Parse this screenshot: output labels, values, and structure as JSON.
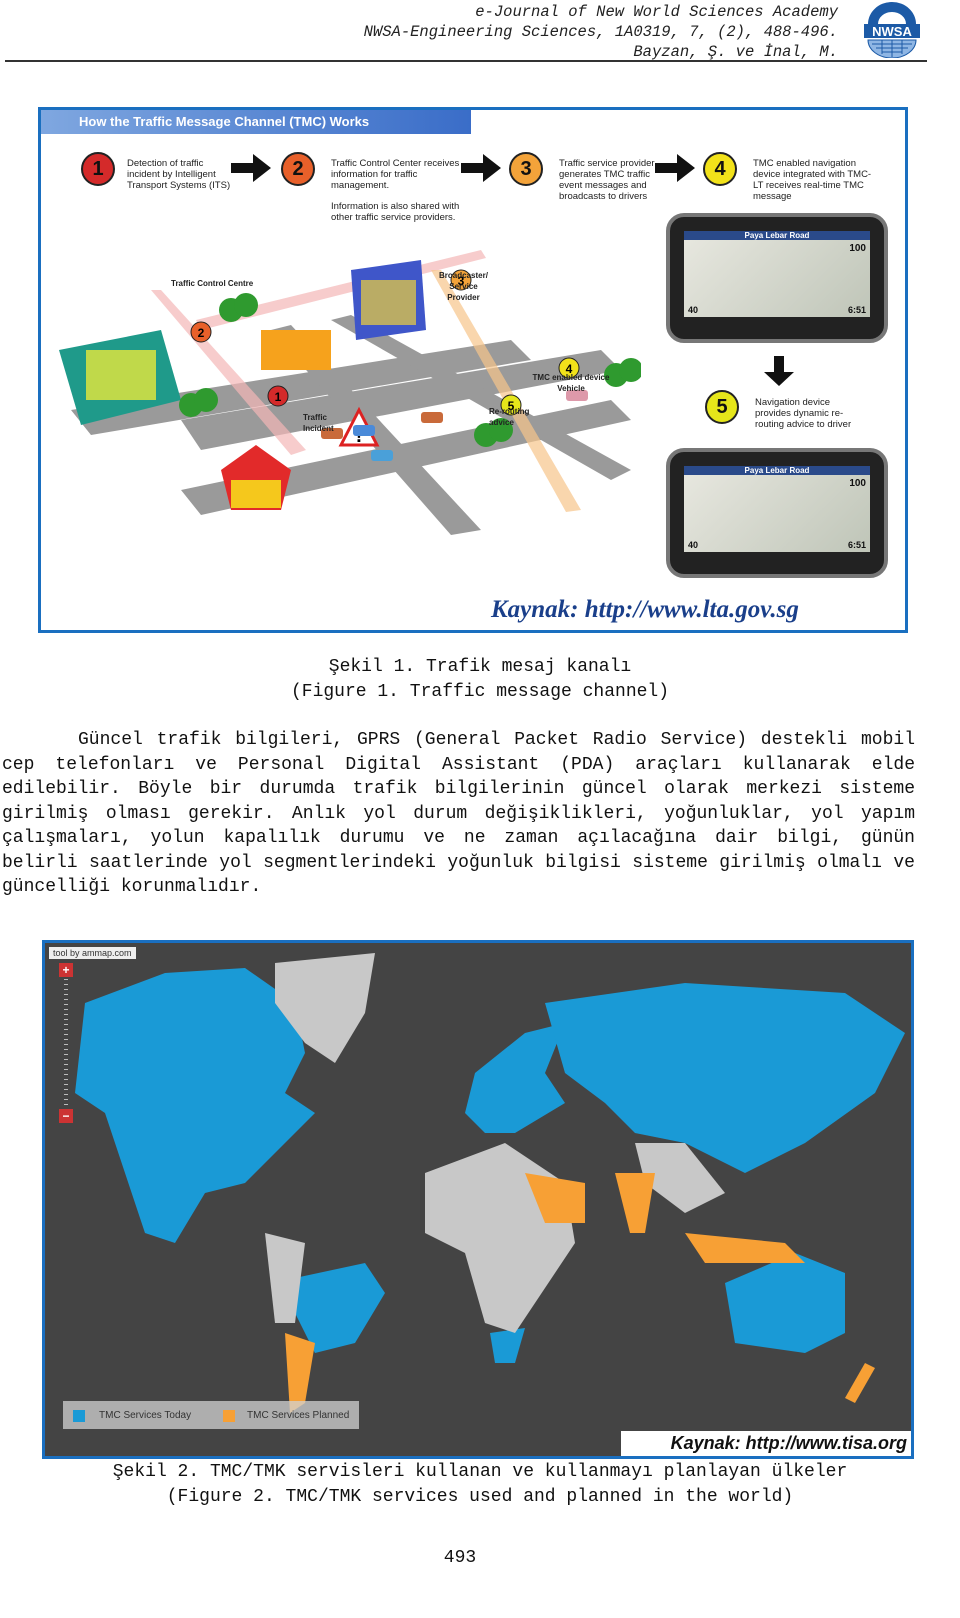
{
  "header": {
    "journal": "e-Journal of New World Sciences Academy",
    "citation": "NWSA-Engineering Sciences, 1A0319, 7, (2), 488-496.",
    "authors": "Bayzan, Ş. ve İnal, M.",
    "logo_text": "NWSA"
  },
  "figure1": {
    "banner": "How the Traffic Message Channel (TMC) Works",
    "steps": [
      {
        "num": "1",
        "text": "Detection of traffic incident by Intelligent Transport Systems (ITS)",
        "color": "#d42a2a"
      },
      {
        "num": "2",
        "text": "Traffic Control Center receives information for traffic management.",
        "extra": "Information is also shared with other traffic service providers.",
        "color": "#e8602a"
      },
      {
        "num": "3",
        "text": "Traffic service provider generates TMC traffic event messages and broadcasts to drivers",
        "color": "#f3a33a"
      },
      {
        "num": "4",
        "text": "TMC enabled navigation device integrated with TMC-LT receives real-time TMC message",
        "color": "#f2e21a"
      },
      {
        "num": "5",
        "text": "Navigation device provides dynamic re-routing advice to driver",
        "color": "#e6e61a"
      }
    ],
    "scene_labels": {
      "control": "Traffic Control Centre",
      "broadcaster": "Broadcaster/ Service Provider",
      "vehicle": "TMC enabled device Vehicle",
      "incident": "Traffic Incident",
      "rerouting": "Re-routing advice"
    },
    "gps": {
      "road": "Paya Lebar Road",
      "distance": "100",
      "speed": "40",
      "time": "6:51"
    },
    "source": "Kaynak: http://www.lta.gov.sg",
    "caption_tr": "Şekil 1. Trafik mesaj kanalı",
    "caption_en": "(Figure 1. Traffic message channel)"
  },
  "paragraph": "Güncel trafik bilgileri, GPRS (General Packet Radio Service) destekli mobil cep telefonları ve Personal Digital Assistant (PDA) araçları kullanarak elde edilebilir. Böyle bir durumda trafik bilgilerinin güncel olarak merkezi sisteme girilmiş olması gerekir. Anlık yol durum değişiklikleri, yoğunluklar, yol yapım çalışmaları, yolun kapalılık durumu ve ne zaman açılacağına dair bilgi, günün belirli saatlerinde yol segmentlerindeki yoğunluk bilgisi sisteme girilmiş olmalı ve güncelliği korunmalıdır.",
  "figure2": {
    "credit": "tool by ammap.com",
    "legend": [
      {
        "label": "TMC Services Today",
        "color": "#1a9ad6"
      },
      {
        "label": "TMC Services Planned",
        "color": "#f7a035"
      }
    ],
    "none_color": "#c8c8c8",
    "background": "#444444",
    "source": "Kaynak: http://www.tisa.org",
    "caption_tr": "Şekil 2. TMC/TMK servisleri kullanan ve kullanmayı planlayan ülkeler",
    "caption_en": "(Figure 2. TMC/TMK services used and planned in the world)"
  },
  "page_number": "493"
}
